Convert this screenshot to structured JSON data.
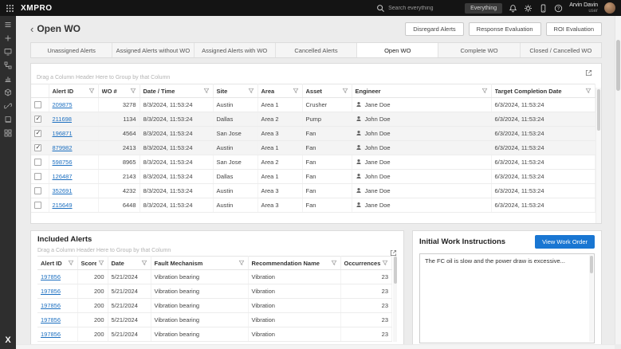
{
  "topbar": {
    "brand": "XMPRO",
    "search_placeholder": "Search everything",
    "scope": "Everything",
    "user_name": "Arvin Davin",
    "user_role": "user"
  },
  "sidebar": {
    "icons": [
      "menu-icon",
      "add-icon",
      "monitor-icon",
      "workflow-icon",
      "chart-icon",
      "asset-icon",
      "link-icon",
      "library-icon",
      "grid-icon"
    ]
  },
  "page": {
    "back_label": "‹",
    "title": "Open WO",
    "actions": [
      "Disregard Alerts",
      "Response Evaluation",
      "ROI Evaluation"
    ]
  },
  "tabs": [
    {
      "label": "Unassigned Alerts",
      "active": false
    },
    {
      "label": "Assigned Alerts without WO",
      "active": false
    },
    {
      "label": "Assigned Alerts with WO",
      "active": false
    },
    {
      "label": "Cancelled Alerts",
      "active": false
    },
    {
      "label": "Open WO",
      "active": true
    },
    {
      "label": "Complete WO",
      "active": false
    },
    {
      "label": "Closed / Cancelled WO",
      "active": false
    }
  ],
  "grid": {
    "group_hint": "Drag a Column Header Here to Group by that Column",
    "columns": [
      "Alert ID",
      "WO #",
      "Date / Time",
      "Site",
      "Area",
      "Asset",
      "Engineer",
      "Target Completion Date"
    ],
    "rows": [
      {
        "checked": false,
        "id": "209875",
        "wo": "3278",
        "datetime": "8/3/2024, 11:53:24",
        "site": "Austin",
        "area": "Area 1",
        "asset": "Crusher",
        "engineer": "Jane Doe",
        "target": "6/3/2024, 11:53:24"
      },
      {
        "checked": true,
        "id": "211698",
        "wo": "1134",
        "datetime": "8/3/2024, 11:53:24",
        "site": "Dallas",
        "area": "Area 2",
        "asset": "Pump",
        "engineer": "John Doe",
        "target": "6/3/2024, 11:53:24"
      },
      {
        "checked": true,
        "id": "196871",
        "wo": "4564",
        "datetime": "8/3/2024, 11:53:24",
        "site": "San Jose",
        "area": "Area 3",
        "asset": "Fan",
        "engineer": "John Doe",
        "target": "6/3/2024, 11:53:24"
      },
      {
        "checked": true,
        "id": "879982",
        "wo": "2413",
        "datetime": "8/3/2024, 11:53:24",
        "site": "Austin",
        "area": "Area 1",
        "asset": "Fan",
        "engineer": "John Doe",
        "target": "6/3/2024, 11:53:24"
      },
      {
        "checked": false,
        "id": "598756",
        "wo": "8965",
        "datetime": "8/3/2024, 11:53:24",
        "site": "San Jose",
        "area": "Area 2",
        "asset": "Fan",
        "engineer": "Jane Doe",
        "target": "6/3/2024, 11:53:24"
      },
      {
        "checked": false,
        "id": "126487",
        "wo": "2143",
        "datetime": "8/3/2024, 11:53:24",
        "site": "Dallas",
        "area": "Area 1",
        "asset": "Fan",
        "engineer": "John Doe",
        "target": "6/3/2024, 11:53:24"
      },
      {
        "checked": false,
        "id": "352691",
        "wo": "4232",
        "datetime": "8/3/2024, 11:53:24",
        "site": "Austin",
        "area": "Area 3",
        "asset": "Fan",
        "engineer": "Jane Doe",
        "target": "6/3/2024, 11:53:24"
      },
      {
        "checked": false,
        "id": "215649",
        "wo": "6448",
        "datetime": "8/3/2024, 11:53:24",
        "site": "Austin",
        "area": "Area 3",
        "asset": "Fan",
        "engineer": "Jane Doe",
        "target": "6/3/2024, 11:53:24"
      }
    ]
  },
  "included_alerts": {
    "title": "Included Alerts",
    "group_hint": "Drag a Column Header Here to Group by that Column",
    "columns": [
      "Alert ID",
      "Score",
      "Date",
      "Fault Mechanism",
      "Recommendation Name",
      "Occurrences"
    ],
    "rows": [
      {
        "id": "197856",
        "score": "200",
        "date": "5/21/2024",
        "fault": "Vibration bearing",
        "recommendation": "Vibration",
        "occurrences": "23"
      },
      {
        "id": "197856",
        "score": "200",
        "date": "5/21/2024",
        "fault": "Vibration bearing",
        "recommendation": "Vibration",
        "occurrences": "23"
      },
      {
        "id": "197856",
        "score": "200",
        "date": "5/21/2024",
        "fault": "Vibration bearing",
        "recommendation": "Vibration",
        "occurrences": "23"
      },
      {
        "id": "197856",
        "score": "200",
        "date": "5/21/2024",
        "fault": "Vibration bearing",
        "recommendation": "Vibration",
        "occurrences": "23"
      },
      {
        "id": "197856",
        "score": "200",
        "date": "5/21/2024",
        "fault": "Vibration bearing",
        "recommendation": "Vibration",
        "occurrences": "23"
      }
    ]
  },
  "work_instructions": {
    "title": "Initial Work Instructions",
    "button_label": "View Work Order",
    "text": "The FC oil is slow and the power draw is excessive..."
  },
  "colors": {
    "accent": "#1976d2",
    "link": "#1c6fc0",
    "topbar_bg": "#141414",
    "sidebar_bg": "#2e2e2e"
  }
}
